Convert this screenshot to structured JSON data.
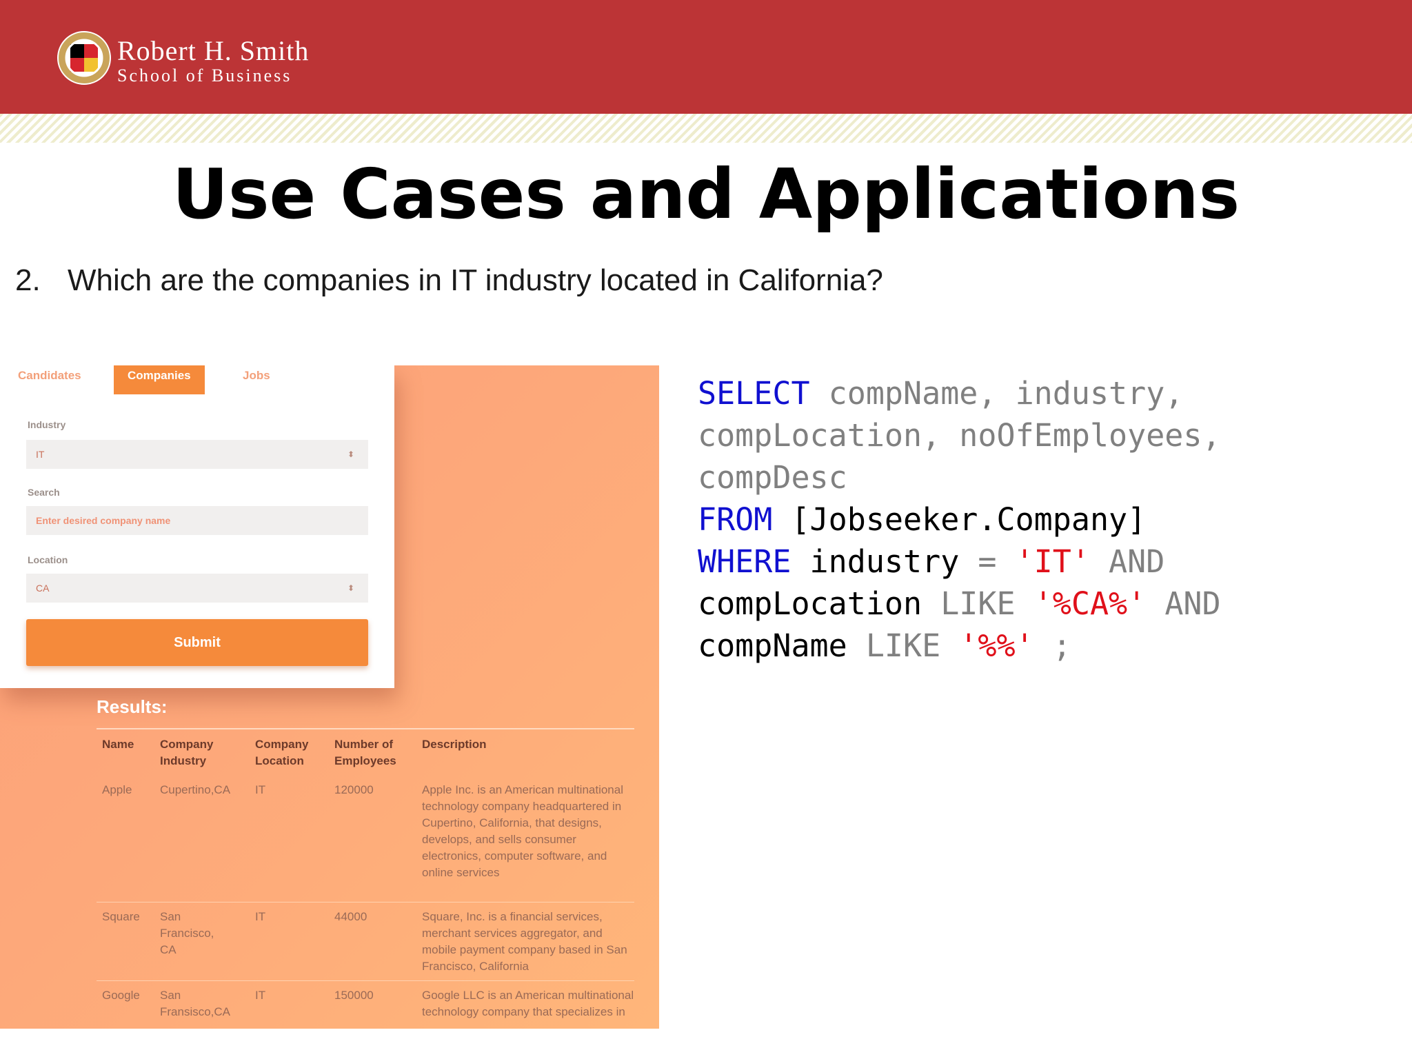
{
  "header": {
    "brand_line1": "Robert H. Smith",
    "brand_line2": "School of Business",
    "colors": {
      "band": "#bc3436",
      "stripe": "#eeeccd"
    },
    "seal_icon": "university-of-maryland-seal"
  },
  "slide": {
    "title": "Use Cases and Applications",
    "question_number": "2.",
    "question_text": "Which are the companies in IT industry located in California?"
  },
  "app": {
    "tabs": [
      "Candidates",
      "Companies",
      "Jobs"
    ],
    "active_tab": "Companies",
    "form": {
      "industry_label": "Industry",
      "industry_value": "IT",
      "search_label": "Search",
      "search_placeholder": "Enter desired company name",
      "location_label": "Location",
      "location_value": "CA",
      "submit_label": "Submit"
    },
    "results_title": "Results:",
    "columns": [
      "Name",
      "Company Industry",
      "Company Location",
      "Number of Employees",
      "Description"
    ],
    "rows": [
      {
        "name": "Apple",
        "industry": "Cupertino,CA",
        "location": "IT",
        "employees": "120000",
        "description": "Apple Inc. is an American multinational technology company headquartered in Cupertino, California, that designs, develops, and sells consumer electronics, computer software, and online services"
      },
      {
        "name": "Square",
        "industry": "San Francisco, CA",
        "location": "IT",
        "employees": "44000",
        "description": "Square, Inc. is a financial services, merchant services aggregator, and mobile payment company based in San Francisco, California"
      },
      {
        "name": "Google",
        "industry": "San Fransisco,CA",
        "location": "IT",
        "employees": "150000",
        "description": "Google LLC is an American multinational technology company that specializes in"
      }
    ]
  },
  "sql": {
    "select_kw": "SELECT",
    "select_cols_1": " compName, industry,",
    "select_cols_2": "compLocation, noOfEmployees,",
    "select_cols_3": "compDesc",
    "from_kw": "FROM",
    "from_table": " [Jobseeker.Company]",
    "where_kw": "WHERE",
    "where_col": " industry",
    "eq": " =",
    "it_str": " 'IT'",
    "and1": " AND",
    "loc_col": "compLocation",
    "like1": " LIKE",
    "ca_str": " '%CA%'",
    "and2": " AND",
    "name_col": "compName",
    "like2": " LIKE",
    "pct_str": " '%%'",
    "semicolon": " ;"
  }
}
